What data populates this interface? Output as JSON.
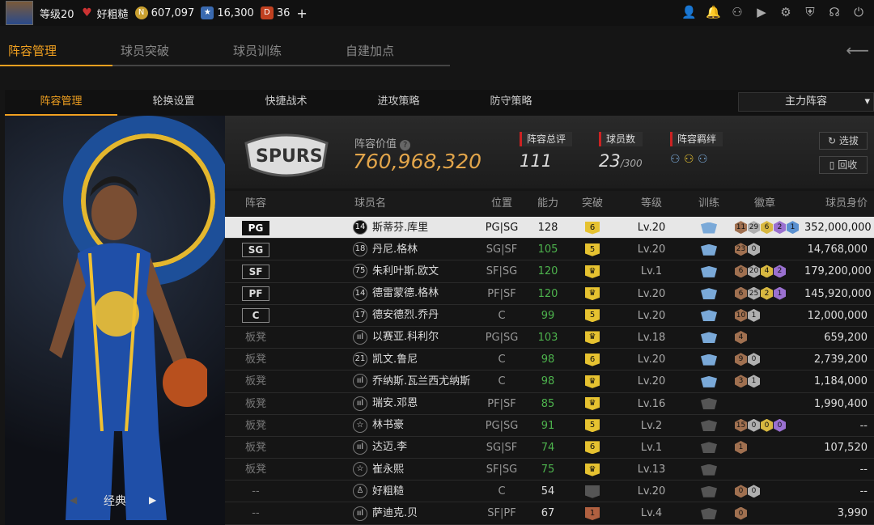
{
  "topbar": {
    "level": "等级20",
    "rep": "好粗糙",
    "coins": "607,097",
    "stars": "16,300",
    "d_count": "36",
    "plus": "+"
  },
  "main_tabs": [
    "阵容管理",
    "球员突破",
    "球员训练",
    "自建加点"
  ],
  "sub_tabs": [
    "阵容管理",
    "轮换设置",
    "快捷战术",
    "进攻策略",
    "防守策略"
  ],
  "lineup_select": "主力阵容",
  "left": {
    "mode": "经典"
  },
  "header": {
    "value_label": "阵容价值",
    "value": "760,968,320",
    "rating_label": "阵容总评",
    "rating": "111",
    "players_label": "球员数",
    "players": "23",
    "players_max": "/300",
    "bond_label": "阵容羁绊",
    "pick_btn": "选拔",
    "recycle_btn": "回收"
  },
  "columns": [
    "阵容",
    "球员名",
    "位置",
    "能力",
    "突破",
    "等级",
    "训练",
    "徽章",
    "球员身价"
  ],
  "rows": [
    {
      "pos": "PG",
      "num": "14",
      "name": "斯蒂芬.库里",
      "p": "PG|SG",
      "abil": "128",
      "br": "6",
      "lv": "Lv.20",
      "val": "352,000,000",
      "badges": [
        "11",
        "29",
        "6",
        "2",
        "1"
      ]
    },
    {
      "pos": "SG",
      "num": "18",
      "name": "丹尼.格林",
      "p": "SG|SF",
      "abil": "105",
      "br": "5",
      "lv": "Lv.20",
      "val": "14,768,000",
      "badges": [
        "23",
        "0"
      ]
    },
    {
      "pos": "SF",
      "num": "75",
      "name": "朱利叶斯.欧文",
      "p": "SF|SG",
      "abil": "120",
      "br": "♛",
      "lv": "Lv.1",
      "val": "179,200,000",
      "badges": [
        "6",
        "20",
        "4",
        "2"
      ]
    },
    {
      "pos": "PF",
      "num": "14",
      "name": "德雷蒙德.格林",
      "p": "PF|SF",
      "abil": "120",
      "br": "♛",
      "lv": "Lv.20",
      "val": "145,920,000",
      "badges": [
        "6",
        "25",
        "2",
        "1"
      ]
    },
    {
      "pos": "C",
      "num": "17",
      "name": "德安德烈.乔丹",
      "p": "C",
      "abil": "99",
      "br": "5",
      "lv": "Lv.20",
      "val": "12,000,000",
      "badges": [
        "10",
        "1"
      ]
    },
    {
      "pos": "板凳",
      "num": "ııl",
      "name": "以赛亚.科利尔",
      "p": "PG|SG",
      "abil": "103",
      "br": "♛",
      "lv": "Lv.18",
      "val": "659,200",
      "badges": [
        "4"
      ]
    },
    {
      "pos": "板凳",
      "num": "21",
      "name": "凯文.鲁尼",
      "p": "C",
      "abil": "98",
      "br": "6",
      "lv": "Lv.20",
      "val": "2,739,200",
      "badges": [
        "9",
        "0"
      ]
    },
    {
      "pos": "板凳",
      "num": "ııl",
      "name": "乔纳斯.瓦兰西尤纳斯",
      "p": "C",
      "abil": "98",
      "br": "♛",
      "lv": "Lv.20",
      "val": "1,184,000",
      "badges": [
        "3",
        "1"
      ]
    },
    {
      "pos": "板凳",
      "num": "ııl",
      "name": "瑞安.邓恩",
      "p": "PF|SF",
      "abil": "85",
      "br": "♛",
      "lv": "Lv.16",
      "val": "1,990,400",
      "badges": []
    },
    {
      "pos": "板凳",
      "num": "☆",
      "name": "林书豪",
      "p": "PG|SG",
      "abil": "91",
      "br": "5",
      "lv": "Lv.2",
      "val": "--",
      "badges": [
        "15",
        "0",
        "0",
        "0"
      ]
    },
    {
      "pos": "板凳",
      "num": "ııl",
      "name": "达迈.李",
      "p": "SG|SF",
      "abil": "74",
      "br": "6",
      "lv": "Lv.1",
      "val": "107,520",
      "badges": [
        "1"
      ]
    },
    {
      "pos": "板凳",
      "num": "☆",
      "name": "崔永熙",
      "p": "SF|SG",
      "abil": "75",
      "br": "♛",
      "lv": "Lv.13",
      "val": "--",
      "badges": []
    },
    {
      "pos": "--",
      "num": "♙",
      "name": "好粗糙",
      "p": "C",
      "abil": "54",
      "br": "",
      "lv": "Lv.20",
      "val": "--",
      "badges": [
        "0",
        "0"
      ]
    },
    {
      "pos": "--",
      "num": "ııl",
      "name": "萨迪克.贝",
      "p": "SF|PF",
      "abil": "67",
      "br": "1",
      "lv": "Lv.4",
      "val": "3,990",
      "badges": [
        "0"
      ]
    }
  ]
}
